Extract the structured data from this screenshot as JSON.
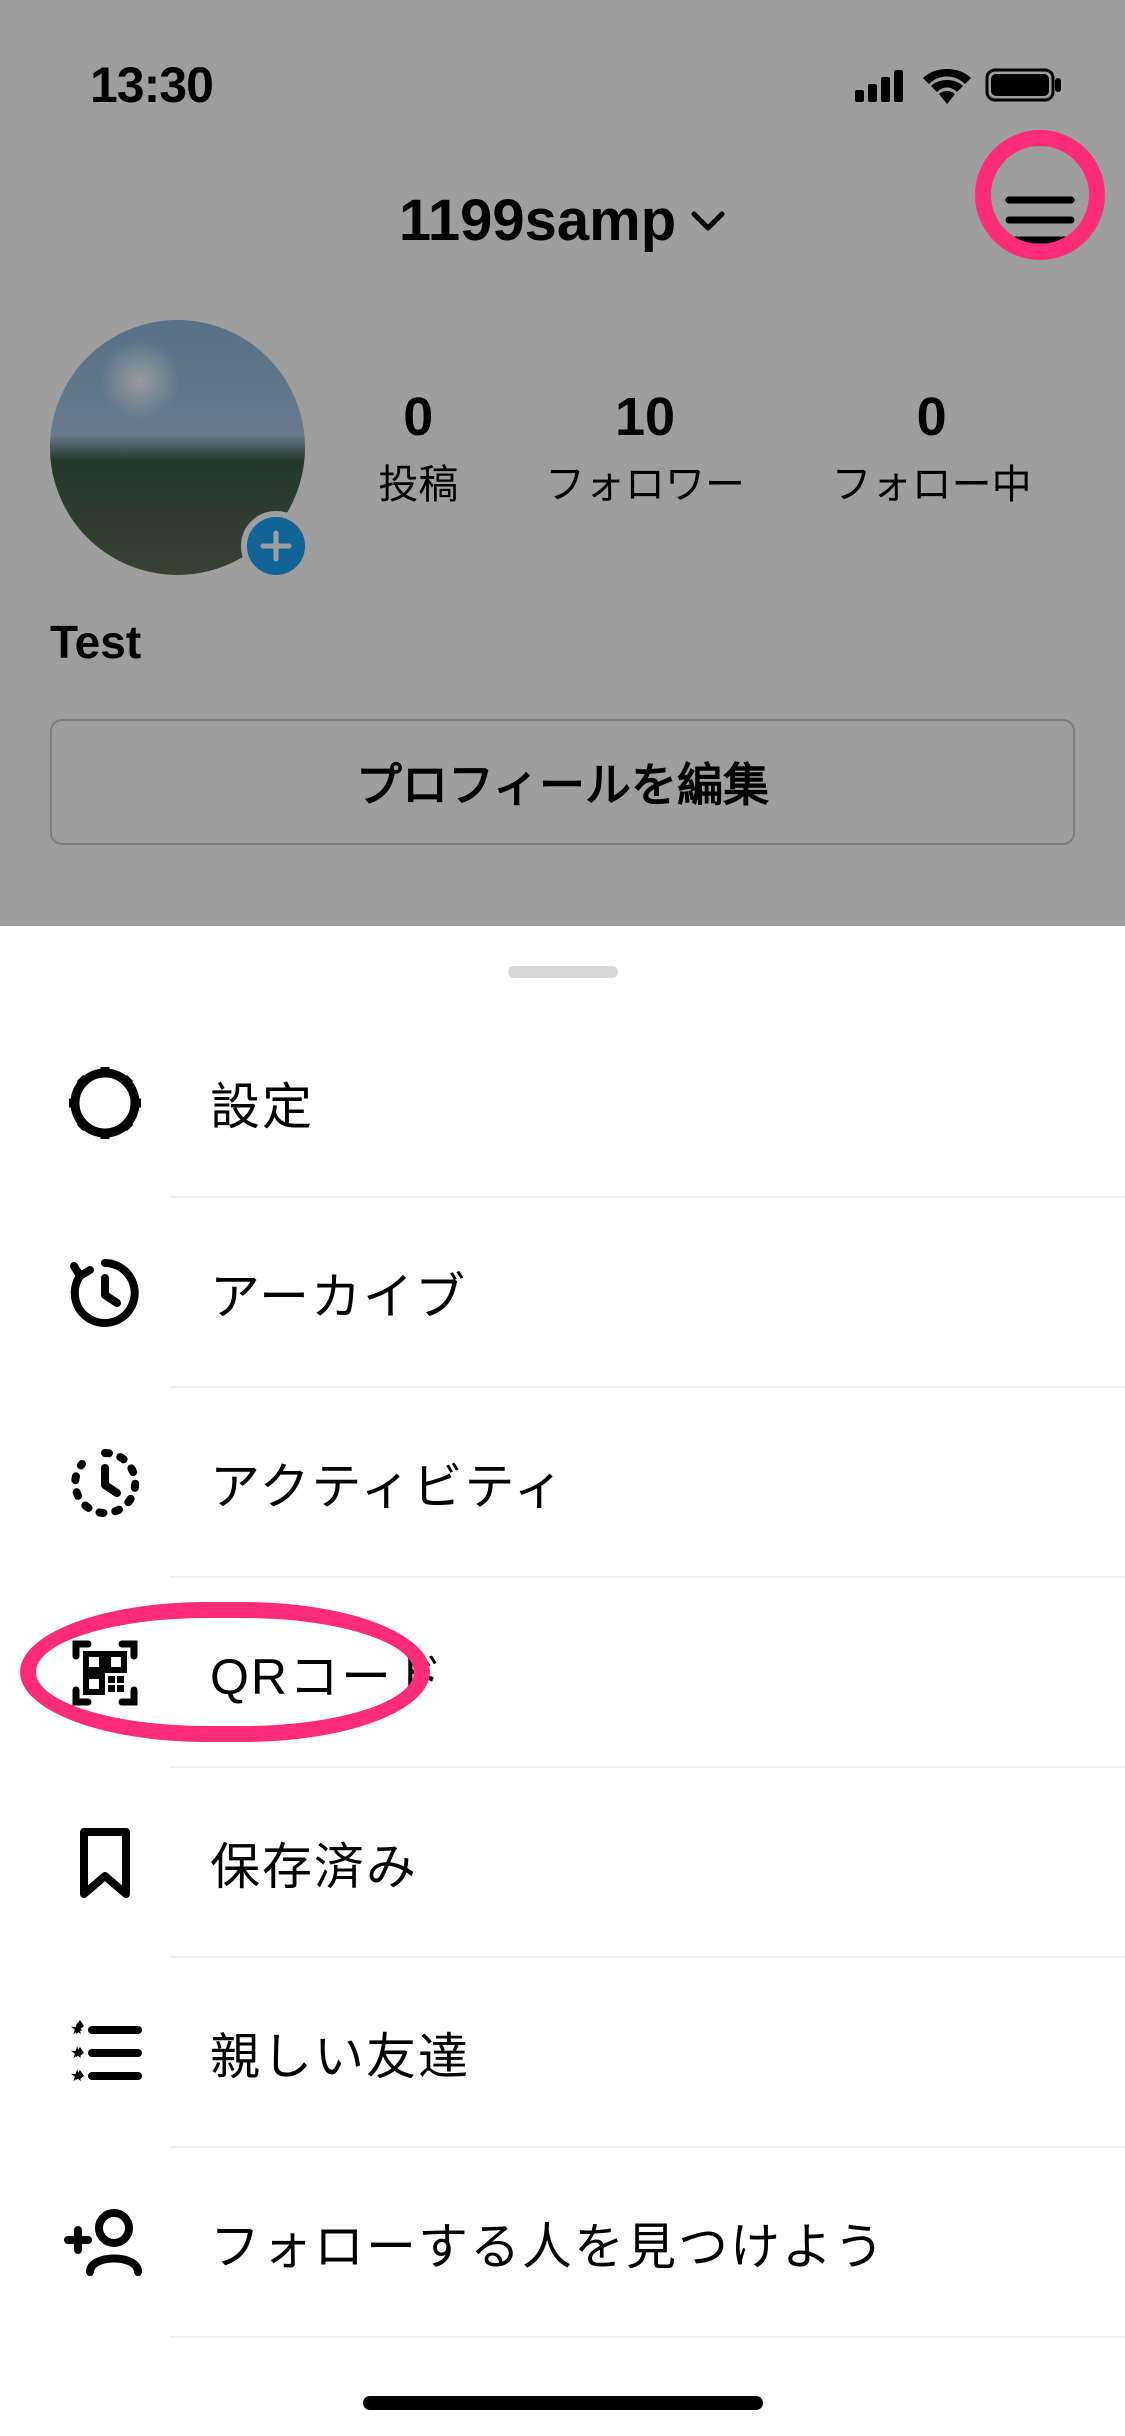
{
  "status": {
    "time": "13:30"
  },
  "header": {
    "username": "1199samp"
  },
  "profile": {
    "stats": {
      "posts_count": "0",
      "posts_label": "投稿",
      "followers_count": "10",
      "followers_label": "フォロワー",
      "following_count": "0",
      "following_label": "フォロー中"
    },
    "display_name": "Test",
    "edit_button": "プロフィールを編集"
  },
  "menu": {
    "settings": "設定",
    "archive": "アーカイブ",
    "activity": "アクティビティ",
    "qr": "QRコード",
    "saved": "保存済み",
    "close_friends": "親しい友達",
    "discover": "フォローする人を見つけよう"
  }
}
